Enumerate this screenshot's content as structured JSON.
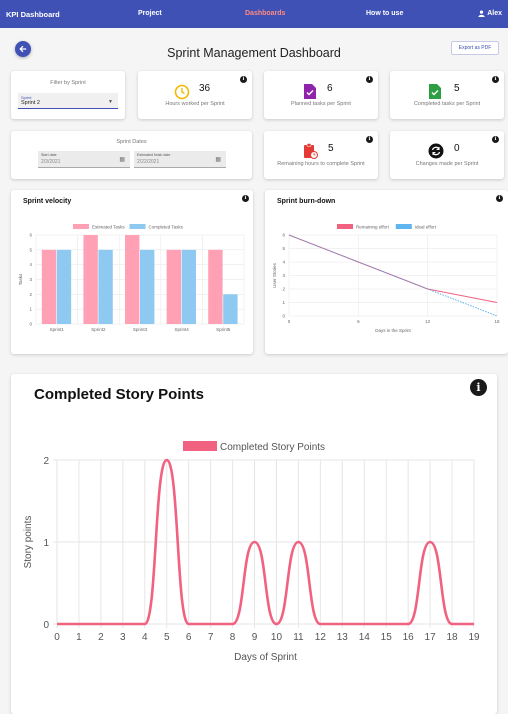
{
  "nav": {
    "brand": "KPI Dashboard",
    "items": [
      {
        "label": "Project",
        "active": false
      },
      {
        "label": "Dashboards",
        "active": true
      },
      {
        "label": "How to use",
        "active": false
      }
    ],
    "user": "Alex",
    "colors": {
      "bar": "#3f51b5",
      "active": "#ff8a80"
    }
  },
  "header": {
    "title": "Sprint Management Dashboard",
    "export_label": "Export as PDF",
    "back_icon": "arrow-left-icon"
  },
  "filter": {
    "title": "Filter by Sprint",
    "select_label": "Sprint",
    "select_value": "Sprint 2"
  },
  "dates": {
    "title": "Sprint Dates",
    "start_label": "Start date",
    "start_value": "2/3/2021",
    "finish_label": "Estimated finish date",
    "finish_value": "2/22/2021"
  },
  "kpis": {
    "hours": {
      "value": "36",
      "label": "Hours worked per Sprint",
      "icon": "clock-icon",
      "color": "#f5b800"
    },
    "planned": {
      "value": "6",
      "label": "Planned tasks per Sprint",
      "icon": "task-file-icon",
      "color": "#8e24aa"
    },
    "completed": {
      "value": "5",
      "label": "Completed tasks per Sprint",
      "icon": "task-done-icon",
      "color": "#2e9e44"
    },
    "remaining": {
      "value": "5",
      "label": "Remaining hours to complete Sprint",
      "icon": "clipboard-clock-icon",
      "color": "#e53935"
    },
    "changes": {
      "value": "0",
      "label": "Changes made per Sprint",
      "icon": "sync-icon",
      "color": "#111111"
    }
  },
  "chart_data": [
    {
      "type": "bar",
      "title": "Sprint velocity",
      "categories": [
        "Sprint1",
        "Sprint2",
        "Sprint3",
        "Sprint4",
        "Sprint5"
      ],
      "series": [
        {
          "name": "Estimated Tasks",
          "values": [
            5,
            6,
            6,
            5,
            5
          ],
          "color": "#ffa0b4"
        },
        {
          "name": "Completed Tasks",
          "values": [
            5,
            5,
            5,
            5,
            2
          ],
          "color": "#8ec9f2"
        }
      ],
      "ylabel": "Tasks",
      "ylim": [
        0,
        6
      ],
      "yticks": [
        0,
        1,
        2,
        3,
        4,
        5,
        6
      ],
      "grid": true,
      "legend": "top"
    },
    {
      "type": "line",
      "title": "Sprint burn-down",
      "x": [
        0,
        6,
        12,
        18
      ],
      "series": [
        {
          "name": "Remaining effort",
          "x": [
            0,
            6,
            12,
            18
          ],
          "values": [
            6,
            4,
            2,
            1
          ],
          "color": "#f06280",
          "style": "solid"
        },
        {
          "name": "Ideal effort",
          "x": [
            0,
            6,
            12,
            18
          ],
          "values": [
            6,
            4,
            2,
            0
          ],
          "color": "#36a2eb",
          "style": "dashed"
        }
      ],
      "xlabel": "Days in the Sprint",
      "ylabel": "User Stories",
      "xticks": [
        0,
        6,
        12,
        18
      ],
      "ylim": [
        0,
        6
      ],
      "yticks": [
        0,
        1,
        2,
        3,
        4,
        5,
        6
      ],
      "grid": true,
      "legend": "top"
    },
    {
      "type": "line",
      "title": "Completed Story Points",
      "x": [
        0,
        1,
        2,
        3,
        4,
        5,
        6,
        7,
        8,
        9,
        10,
        11,
        12,
        13,
        14,
        15,
        16,
        17,
        18,
        19
      ],
      "series": [
        {
          "name": "Completed Story Points",
          "values": [
            0,
            0,
            0,
            0,
            0,
            2,
            0,
            0,
            0,
            1,
            0,
            1,
            0,
            0,
            0,
            0,
            0,
            1,
            0,
            0
          ],
          "color": "#f06280"
        }
      ],
      "xlabel": "Days of Sprint",
      "ylabel": "Story points",
      "ylim": [
        0,
        2
      ],
      "yticks": [
        0,
        1,
        2
      ],
      "grid": true,
      "legend": "top"
    }
  ]
}
